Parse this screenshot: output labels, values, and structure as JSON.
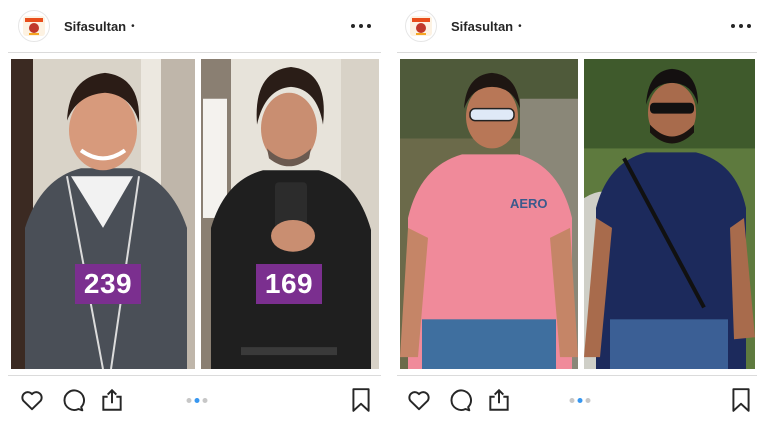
{
  "posts": [
    {
      "username": "Sifasultan",
      "separator": "•",
      "before_weight": "239",
      "after_weight": "169",
      "carousel_count": 3,
      "carousel_active": 1
    },
    {
      "username": "Sifasultan",
      "separator": "•",
      "carousel_count": 3,
      "carousel_active": 1
    }
  ],
  "icons": {
    "like": "heart-icon",
    "comment": "comment-icon",
    "share": "share-icon",
    "save": "bookmark-icon",
    "more": "more-options-icon"
  },
  "colors": {
    "badge": "#7b2f8f",
    "active_dot": "#3897f0",
    "inactive_dot": "#c7c7c7"
  }
}
